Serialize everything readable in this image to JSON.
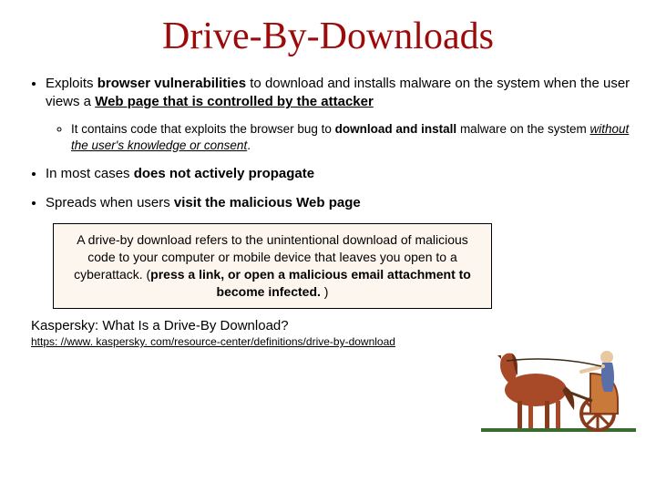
{
  "title": "Drive-By-Downloads",
  "bullets": {
    "b1a": "Exploits ",
    "b1b": "browser vulnerabilities",
    "b1c": " to download and installs malware on the system when the user views a ",
    "b1d": "Web page that is controlled by the attacker",
    "sub1a": "It contains code that exploits the browser bug to ",
    "sub1b": "download and install",
    "sub1c": " malware on the system ",
    "sub1d": "without the user's knowledge or consent",
    "sub1e": ".",
    "b2a": "In most cases ",
    "b2b": "does not actively propagate",
    "b3a": "Spreads when users ",
    "b3b": "visit the malicious Web page"
  },
  "callout": {
    "c1": "A drive-by download refers to the unintentional download of malicious code to your computer or mobile device that leaves you open to a cyberattack. (",
    "c2": "press a link, or open a malicious email attachment to become infected.",
    "c3": " )"
  },
  "ref": {
    "label": "Kaspersky: What Is a Drive-By Download?",
    "url": "https: //www. kaspersky. com/resource-center/definitions/drive-by-download"
  },
  "image_alt": "chariot-clipart"
}
